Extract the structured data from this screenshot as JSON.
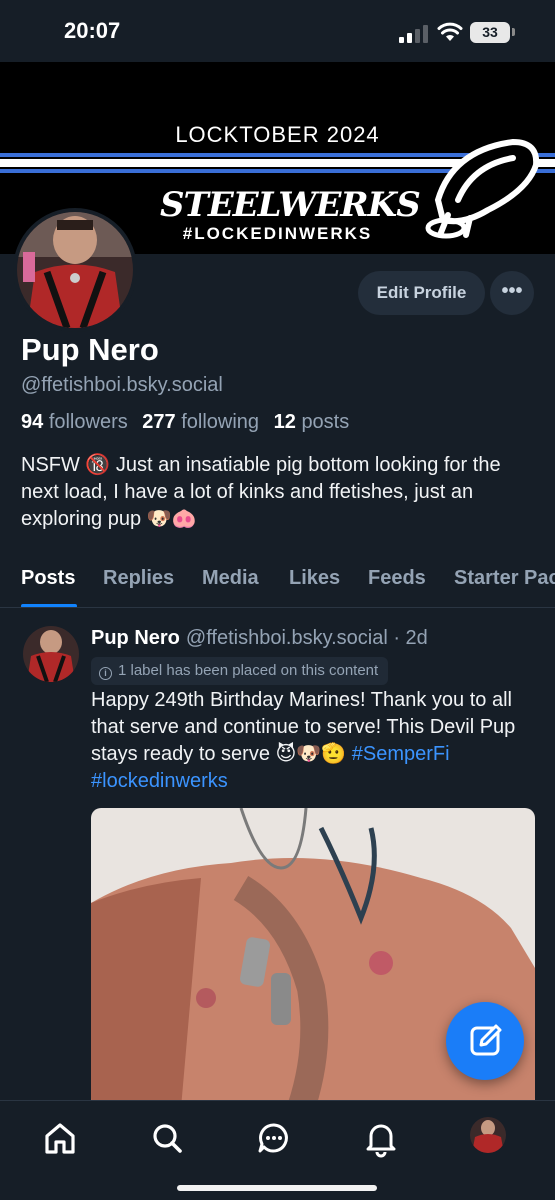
{
  "status": {
    "time": "20:07",
    "battery": "33"
  },
  "banner": {
    "title": "LOCKTOBER 2024",
    "brand": "STEELWERKS",
    "tagline": "#LOCKEDINWERKS"
  },
  "profile": {
    "display_name": "Pup Nero",
    "handle": "@ffetishboi.bsky.social",
    "edit_label": "Edit Profile",
    "more_label": "•••",
    "followers_count": "94",
    "followers_label": "followers",
    "following_count": "277",
    "following_label": "following",
    "posts_count": "12",
    "posts_label": "posts",
    "bio": "NSFW 🔞 Just an insatiable pig bottom looking for the next load, I have a lot of kinks and ffetishes, just an exploring pup 🐶🐽"
  },
  "tabs": [
    "Posts",
    "Replies",
    "Media",
    "Likes",
    "Feeds",
    "Starter Pac"
  ],
  "post": {
    "author": "Pup Nero",
    "handle": "@ffetishboi.bsky.social",
    "time": "· 2d",
    "label_notice": "1 label has been placed on this content",
    "text": "Happy 249th Birthday Marines! Thank you to all that serve and continue to serve! This Devil Pup stays ready to serve 😈🐶🫡",
    "hashtags": "#SemperFi #lockedinwerks"
  },
  "colors": {
    "background": "#161e27",
    "accent": "#1183fe",
    "muted": "#94a3b4",
    "button": "#232e3b"
  },
  "icons": {
    "nav": [
      "home-icon",
      "search-icon",
      "chat-icon",
      "bell-icon",
      "profile-avatar"
    ],
    "fab": "compose-icon"
  }
}
